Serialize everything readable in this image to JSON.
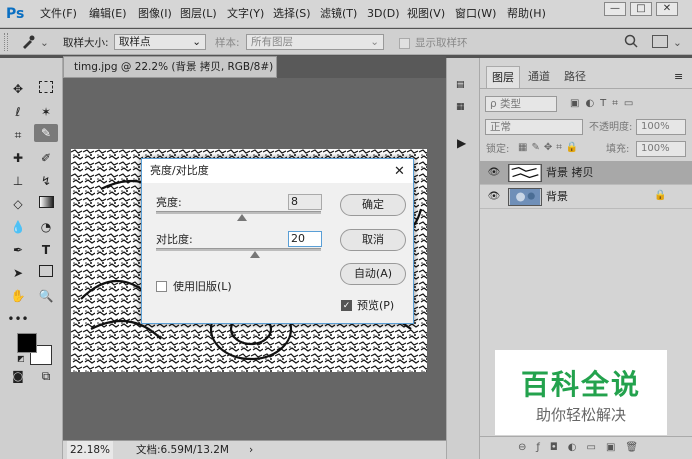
{
  "app": {
    "logo": "Ps"
  },
  "menu": [
    "文件(F)",
    "编辑(E)",
    "图像(I)",
    "图层(L)",
    "文字(Y)",
    "选择(S)",
    "滤镜(T)",
    "3D(D)",
    "视图(V)",
    "窗口(W)",
    "帮助(H)"
  ],
  "window_controls": {
    "minimize": "—",
    "restore": "□",
    "close": "✕"
  },
  "options": {
    "sample_size_label": "取样大小:",
    "sample_size_value": "取样点",
    "sample_label": "样本:",
    "sample_value": "所有图层",
    "show_ring_label": "显示取样环"
  },
  "document": {
    "tab_title": "timg.jpg @ 22.2% (背景 拷贝, RGB/8#) *",
    "tab_close": "×",
    "zoom": "22.18%",
    "doc_size": "文档:6.59M/13.2M"
  },
  "dialog": {
    "title": "亮度/对比度",
    "close": "✕",
    "brightness_label": "亮度:",
    "brightness_value": "8",
    "brightness_fraction": 0.52,
    "contrast_label": "对比度:",
    "contrast_value": "20",
    "contrast_fraction": 0.6,
    "legacy_label": "使用旧版(L)",
    "preview_label": "预览(P)",
    "preview_check": "✓",
    "ok": "确定",
    "cancel": "取消",
    "auto": "自动(A)"
  },
  "layers_panel": {
    "tabs": [
      "图层",
      "通道",
      "路径"
    ],
    "filter_label": "ρ 类型",
    "blend_mode": "正常",
    "opacity_label": "不透明度:",
    "opacity_value": "100%",
    "lock_label": "锁定:",
    "fill_label": "填充:",
    "fill_value": "100%",
    "layers": [
      {
        "name": "背景 拷贝",
        "selected": true
      },
      {
        "name": "背景",
        "locked": true
      }
    ]
  },
  "watermark": {
    "title": "百科全说",
    "subtitle": "助你轻松解决"
  },
  "colors": {
    "accent": "#5a9fd6",
    "selected_layer": "#a8a8a8",
    "watermark_green": "#23a24d"
  }
}
